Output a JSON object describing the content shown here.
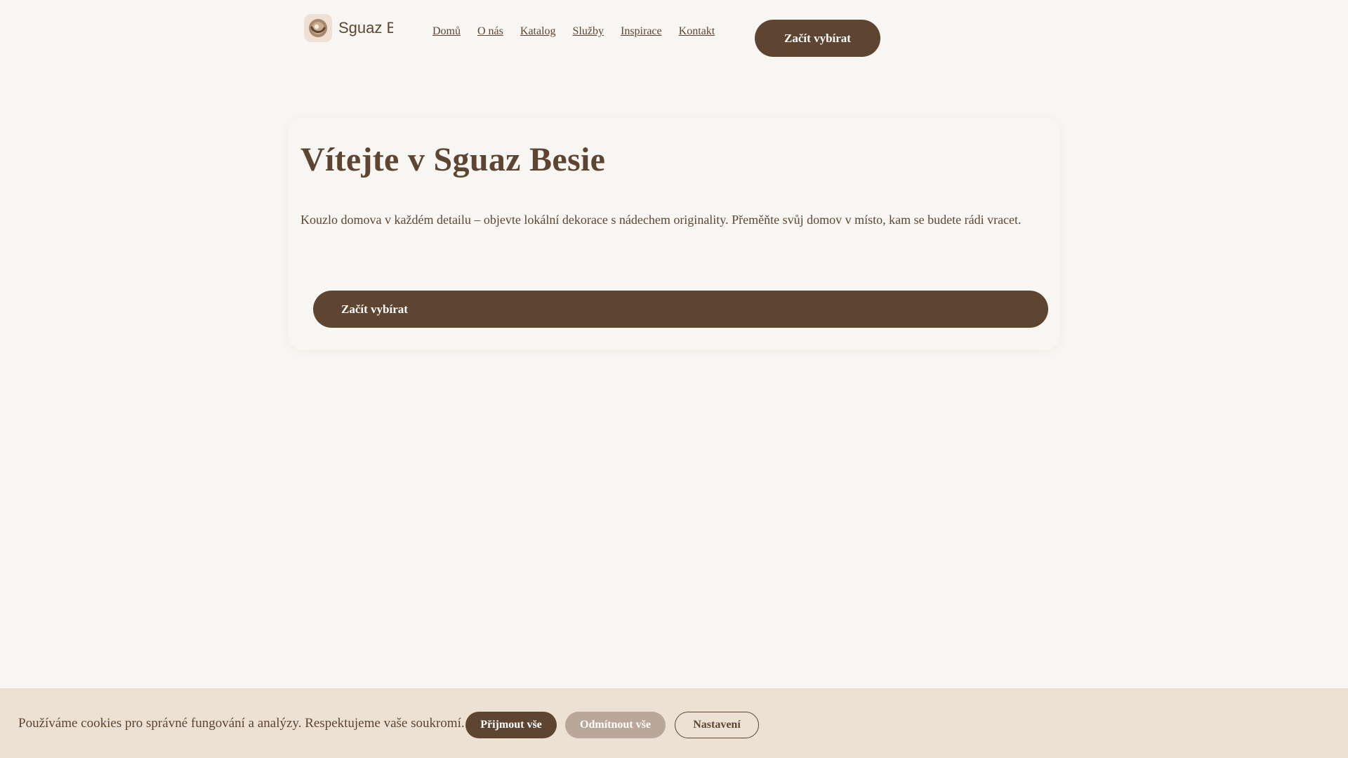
{
  "header": {
    "logo_text": "Sguaz Besie",
    "logo_icon": "swirl-logo-icon",
    "nav": [
      {
        "label": "Domů"
      },
      {
        "label": "O nás"
      },
      {
        "label": "Katalog"
      },
      {
        "label": "Služby"
      },
      {
        "label": "Inspirace"
      },
      {
        "label": "Kontakt"
      }
    ],
    "cta_label": "Začít vybírat"
  },
  "hero": {
    "title": "Vítejte v Sguaz Besie",
    "description": "Kouzlo domova v každém detailu – objevte lokální dekorace s nádechem originality. Přeměňte svůj domov v místo, kam se budete rádi vracet.",
    "cta_label": "Začít vybírat"
  },
  "cookie_banner": {
    "text": "Používáme cookies pro správné fungování a analýzy. Respektujeme vaše soukromí.",
    "accept_label": "Přijmout vše",
    "reject_label": "Odmítnout vše",
    "settings_label": "Nastavení"
  },
  "colors": {
    "background": "#f8f6f2",
    "primary": "#5e4532",
    "banner": "#ece1d3",
    "muted_button": "#b9a899"
  }
}
